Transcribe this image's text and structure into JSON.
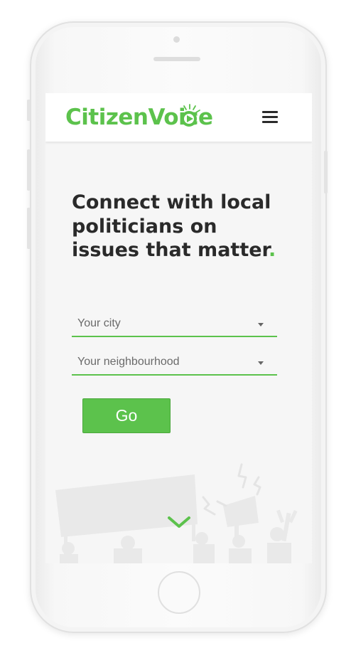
{
  "app": {
    "logo_text": "CitizenVoice",
    "brand_color": "#5cc24c",
    "text_color": "#2a2a2a"
  },
  "header": {
    "logo_mark_icon": "megaphone-o-icon",
    "menu_icon": "hamburger-menu-icon"
  },
  "hero": {
    "headline": "Connect with local politicians on issues that matter",
    "headline_punctuation": "."
  },
  "form": {
    "city_select": {
      "value": "Your city",
      "icon": "caret-down-icon"
    },
    "neighbourhood_select": {
      "value": "Your neighbourhood",
      "icon": "caret-down-icon"
    },
    "submit_label": "Go"
  },
  "footer": {
    "scroll_icon": "chevron-down-icon",
    "background_illustration": "protest-crowd-illustration"
  }
}
